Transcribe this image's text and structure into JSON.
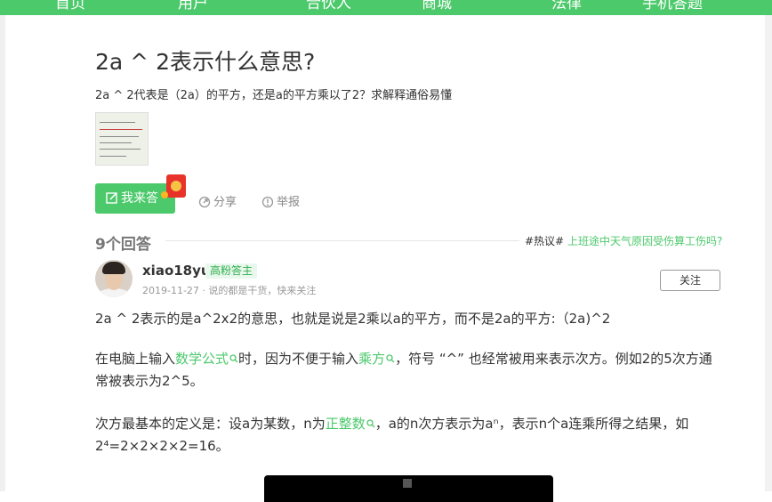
{
  "nav": {
    "items": [
      "首页",
      "用户",
      "合伙人",
      "商城",
      "法律",
      "手机答题"
    ]
  },
  "question": {
    "title": "2a ^ 2表示什么意思?",
    "description": "2a ^ 2代表是（2a）的平方，还是a的平方乘以了2？求解释通俗易懂"
  },
  "actions": {
    "answer_label": "我来答",
    "share_label": "分享",
    "report_label": "举报"
  },
  "answers": {
    "count_label": "9个回答",
    "hot_tag": "#热议#",
    "hot_link": "上班途中天气原因受伤算工伤吗?"
  },
  "answer": {
    "username": "xiao18yu",
    "badge": "高粉答主",
    "meta": "2019-11-27 · 说的都是干货，快来关注",
    "follow_label": "关注",
    "p1": "2a ^ 2表示的是a^2x2的意思，也就是说是2乘以a的平方，而不是2a的平方:（2a)^2",
    "p2_a": "在电脑上输入",
    "p2_kw1": "数学公式",
    "p2_b": "时，因为不便于输入",
    "p2_kw2": "乘方",
    "p2_c": "，符号 “^” 也经常被用来表示次方。例如2的5次方通常被表示为2^5。",
    "p3_a": "次方最基本的定义是：设a为某数，n为",
    "p3_kw": "正整数",
    "p3_b": "，a的n次方表示为aⁿ，表示n个a连乘所得之结果，如2⁴=2×2×2×2=16。"
  },
  "colors": {
    "brand_green": "#4cc96b",
    "red_packet": "#e8332b"
  }
}
